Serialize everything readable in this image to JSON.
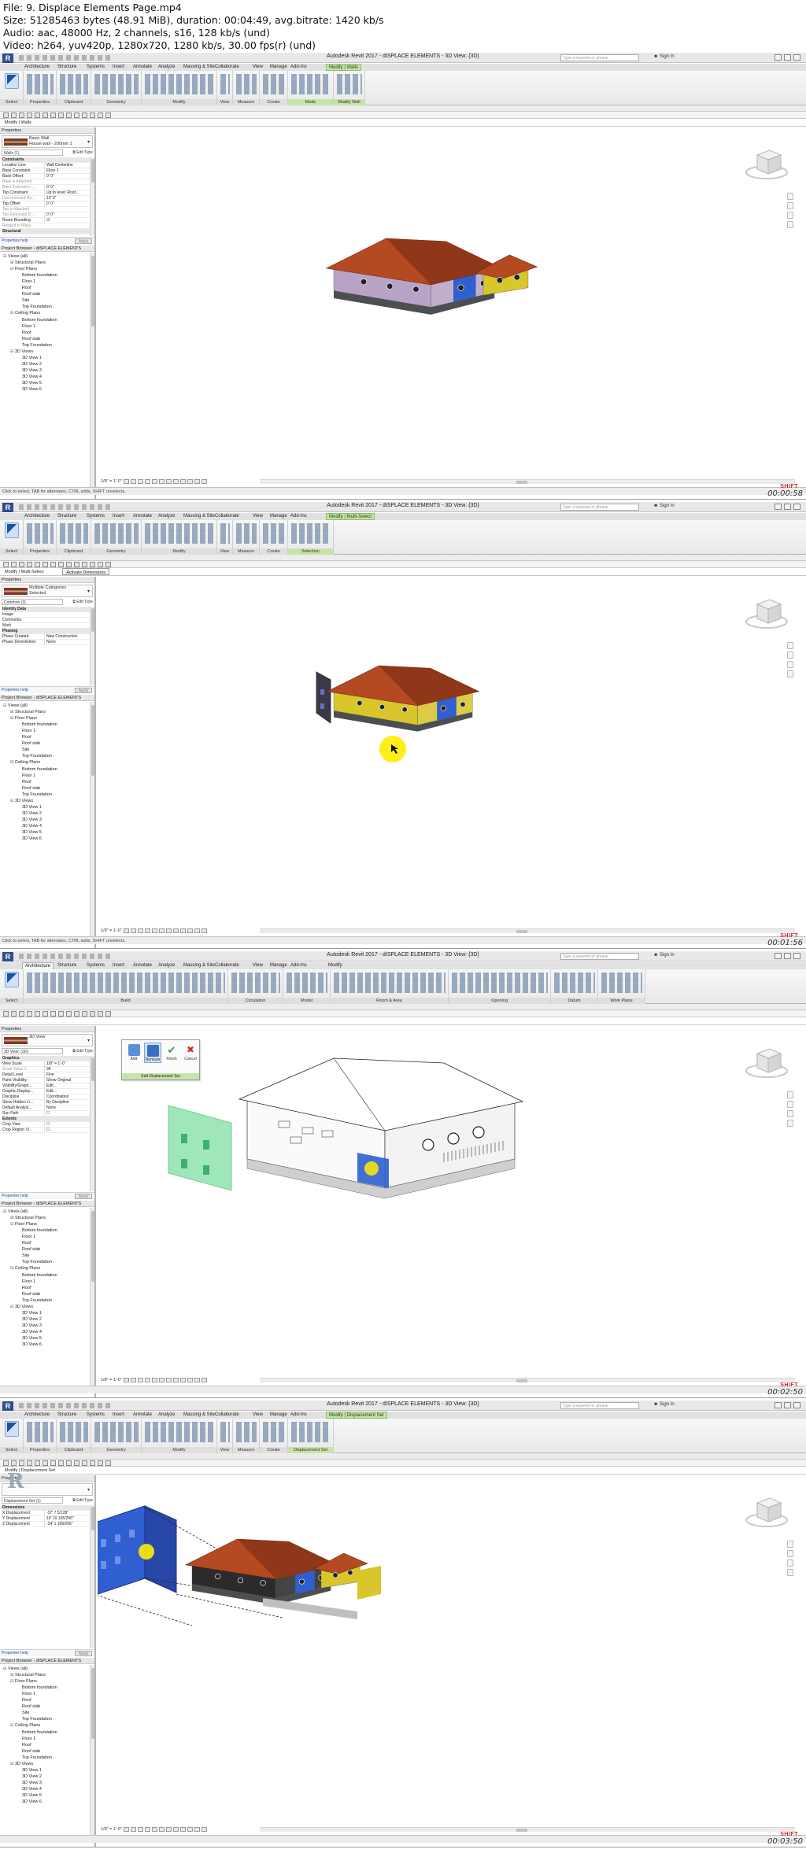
{
  "file_info": [
    "File: 9. Displace Elements Page.mp4",
    "Size: 51285463 bytes (48.91 MiB), duration: 00:04:49, avg.bitrate: 1420 kb/s",
    "Audio: aac, 48000 Hz, 2 channels, s16, 128 kb/s (und)",
    "Video: h264, yuv420p, 1280x720, 1280 kb/s, 30.00 fps(r) (und)"
  ],
  "common": {
    "app_logo": "R",
    "search_placeholder": "Type a keyword or phrase",
    "sign_in": "Sign In",
    "watermark_logo": "SHIFT",
    "apply_label": "Apply",
    "properties_help": "Properties help",
    "edit_type": "Edit Type",
    "view_scale": "1/8\" = 1'-0\""
  },
  "colors": {
    "ctx_tab_green": "#c6e3a9",
    "roof_brown": "#b54a22",
    "wall_yellow": "#d8c62a",
    "wall_lilac": "#b8a3c7",
    "displace_blue": "#2f5fd0",
    "ghost_green": "#7fe0a2",
    "cursor_yellow": "#ffec00"
  },
  "frames": [
    {
      "title": "Autodesk Revit 2017 -   dISPLACE ELEMENTS - 3D View: {3D}",
      "tabs": [
        "Architecture",
        "Structure",
        "Systems",
        "Insert",
        "Annotate",
        "Analyze",
        "Massing & Site",
        "Collaborate",
        "View",
        "Manage",
        "Add-Ins",
        "Modify | Walls"
      ],
      "active_tab": "Modify | Walls",
      "panels": [
        "Select",
        "Properties",
        "Clipboard",
        "Geometry",
        "Modify",
        "View",
        "Measure",
        "Create",
        "Mode",
        "Modify Wall"
      ],
      "subbar": [
        "Select ▾",
        "Properties",
        "Clipboard",
        "Geometry",
        "Modify",
        "View",
        "Measure",
        "Create",
        "Mode",
        "Modify Wall"
      ],
      "ctx_bar": [
        "Modify | Walls"
      ],
      "type_name": "Basic Wall",
      "type_sub": "House wall - 200mm 1",
      "type_filter": "Walls (1)",
      "properties": [
        {
          "k": "Constraints",
          "v": "",
          "cat": true
        },
        {
          "k": "Location Line",
          "v": "Wall Centerline"
        },
        {
          "k": "Base Constraint",
          "v": "Floor 1"
        },
        {
          "k": "Base Offset",
          "v": "0' 0\""
        },
        {
          "k": "Base is Attached",
          "v": "",
          "grey": true
        },
        {
          "k": "Base Extension ...",
          "v": "0' 0\"",
          "grey": true
        },
        {
          "k": "Top Constraint",
          "v": "Up to level: Roof..."
        },
        {
          "k": "Unconnected He...",
          "v": "10' 0\"",
          "grey": true
        },
        {
          "k": "Top Offset",
          "v": "0' 0\""
        },
        {
          "k": "Top is Attached",
          "v": "",
          "grey": true
        },
        {
          "k": "Top Extension D...",
          "v": "0' 0\"",
          "grey": true
        },
        {
          "k": "Room Bounding",
          "v": "☑"
        },
        {
          "k": "Related to Mass",
          "v": "",
          "grey": true
        },
        {
          "k": "Structural",
          "v": "",
          "cat": true
        }
      ],
      "browser_title": "Project Browser - dISPLACE ELEMENTS",
      "browser": [
        {
          "t": "Views (all)",
          "l": 0,
          "g": "⊟"
        },
        {
          "t": "Structural Plans",
          "l": 1,
          "g": "⊞"
        },
        {
          "t": "Floor Plans",
          "l": 1,
          "g": "⊟"
        },
        {
          "t": "Bottom foundation",
          "l": 2,
          "g": ""
        },
        {
          "t": "Floor 1",
          "l": 2,
          "g": ""
        },
        {
          "t": "Roof",
          "l": 2,
          "g": ""
        },
        {
          "t": "Roof slab",
          "l": 2,
          "g": ""
        },
        {
          "t": "Site",
          "l": 2,
          "g": ""
        },
        {
          "t": "Top Foundation",
          "l": 2,
          "g": ""
        },
        {
          "t": "Ceiling Plans",
          "l": 1,
          "g": "⊟"
        },
        {
          "t": "Bottom foundation",
          "l": 2,
          "g": ""
        },
        {
          "t": "Floor 1",
          "l": 2,
          "g": ""
        },
        {
          "t": "Roof",
          "l": 2,
          "g": ""
        },
        {
          "t": "Roof slab",
          "l": 2,
          "g": ""
        },
        {
          "t": "Top Foundation",
          "l": 2,
          "g": ""
        },
        {
          "t": "3D Views",
          "l": 1,
          "g": "⊟"
        },
        {
          "t": "3D View 1",
          "l": 2,
          "g": ""
        },
        {
          "t": "3D View 2",
          "l": 2,
          "g": ""
        },
        {
          "t": "3D View 3",
          "l": 2,
          "g": ""
        },
        {
          "t": "3D View 4",
          "l": 2,
          "g": ""
        },
        {
          "t": "3D View 5",
          "l": 2,
          "g": ""
        },
        {
          "t": "3D View 6",
          "l": 2,
          "g": ""
        }
      ],
      "status": "Click to select, TAB for alternates, CTRL adds, SHIFT unselects.",
      "timestamp": "00:00:58"
    },
    {
      "title": "Autodesk Revit 2017 -   dISPLACE ELEMENTS - 3D View: {3D}",
      "tabs": [
        "Architecture",
        "Structure",
        "Systems",
        "Insert",
        "Annotate",
        "Analyze",
        "Massing & Site",
        "Collaborate",
        "View",
        "Manage",
        "Add-Ins",
        "Modify | Multi-Select"
      ],
      "active_tab": "Modify | Multi-Select",
      "panels": [
        "Select",
        "Properties",
        "Clipboard",
        "Geometry",
        "Modify",
        "View",
        "Measure",
        "Create",
        "Selection"
      ],
      "subbar": [
        "Select ▾",
        "Properties",
        "Clipboard",
        "Geometry",
        "Modify",
        "View",
        "Measure",
        "Create",
        "Selection"
      ],
      "ctx_bar": [
        "Modify | Multi-Select",
        "Activate Dimensions"
      ],
      "type_name": "Multiple Categories",
      "type_sub": "Selected",
      "type_filter": "Common (3)",
      "properties": [
        {
          "k": "Identity Data",
          "v": "",
          "cat": true
        },
        {
          "k": "Image",
          "v": ""
        },
        {
          "k": "Comments",
          "v": ""
        },
        {
          "k": "Mark",
          "v": ""
        },
        {
          "k": "Phasing",
          "v": "",
          "cat": true
        },
        {
          "k": "Phase Created",
          "v": "New Construction"
        },
        {
          "k": "Phase Demolished",
          "v": "None"
        }
      ],
      "browser_title": "Project Browser - dISPLACE ELEMENTS",
      "browser": [
        {
          "t": "Views (all)",
          "l": 0,
          "g": "⊟"
        },
        {
          "t": "Structural Plans",
          "l": 1,
          "g": "⊞"
        },
        {
          "t": "Floor Plans",
          "l": 1,
          "g": "⊟"
        },
        {
          "t": "Bottom foundation",
          "l": 2,
          "g": ""
        },
        {
          "t": "Floor 1",
          "l": 2,
          "g": ""
        },
        {
          "t": "Roof",
          "l": 2,
          "g": ""
        },
        {
          "t": "Roof slab",
          "l": 2,
          "g": ""
        },
        {
          "t": "Site",
          "l": 2,
          "g": ""
        },
        {
          "t": "Top Foundation",
          "l": 2,
          "g": ""
        },
        {
          "t": "Ceiling Plans",
          "l": 1,
          "g": "⊟"
        },
        {
          "t": "Bottom foundation",
          "l": 2,
          "g": ""
        },
        {
          "t": "Floor 1",
          "l": 2,
          "g": ""
        },
        {
          "t": "Roof",
          "l": 2,
          "g": ""
        },
        {
          "t": "Roof slab",
          "l": 2,
          "g": ""
        },
        {
          "t": "Top Foundation",
          "l": 2,
          "g": ""
        },
        {
          "t": "3D Views",
          "l": 1,
          "g": "⊟"
        },
        {
          "t": "3D View 1",
          "l": 2,
          "g": ""
        },
        {
          "t": "3D View 2",
          "l": 2,
          "g": ""
        },
        {
          "t": "3D View 3",
          "l": 2,
          "g": ""
        },
        {
          "t": "3D View 4",
          "l": 2,
          "g": ""
        },
        {
          "t": "3D View 5",
          "l": 2,
          "g": ""
        },
        {
          "t": "3D View 6",
          "l": 2,
          "g": ""
        }
      ],
      "status": "Click to select, TAB for alternates, CTRL adds, SHIFT unselects.",
      "timestamp": "00:01:56"
    },
    {
      "title": "Autodesk Revit 2017 -   dISPLACE ELEMENTS - 3D View: {3D}",
      "tabs": [
        "Architecture",
        "Structure",
        "Systems",
        "Insert",
        "Annotate",
        "Analyze",
        "Massing & Site",
        "Collaborate",
        "View",
        "Manage",
        "Add-Ins",
        "Modify"
      ],
      "active_tab": "Architecture",
      "panels": [
        "Select",
        "Build",
        "Circulation",
        "Model",
        "Room & Area",
        "Opening",
        "Datum",
        "Work Plane"
      ],
      "subbar": [
        "Select ▾",
        "Build",
        "Circulation",
        "Model",
        "Room & Area ▾",
        "Opening",
        "Datum",
        "Work Plane"
      ],
      "ctx_bar": [],
      "type_name": "3D View",
      "type_sub": "",
      "type_filter": "3D View: {3D}",
      "properties": [
        {
          "k": "Graphics",
          "v": "",
          "cat": true
        },
        {
          "k": "View Scale",
          "v": "1/8\" = 1'-0\""
        },
        {
          "k": "Scale Value  1:",
          "v": "96",
          "grey": true
        },
        {
          "k": "Detail Level",
          "v": "Fine"
        },
        {
          "k": "Parts Visibility",
          "v": "Show Original"
        },
        {
          "k": "Visibility/Graph...",
          "v": "Edit..."
        },
        {
          "k": "Graphic Display...",
          "v": "Edit..."
        },
        {
          "k": "Discipline",
          "v": "Coordination"
        },
        {
          "k": "Show Hidden Li...",
          "v": "By Discipline"
        },
        {
          "k": "Default Analysi...",
          "v": "None"
        },
        {
          "k": "Sun Path",
          "v": "☐"
        },
        {
          "k": "Extents",
          "v": "",
          "cat": true
        },
        {
          "k": "Crop View",
          "v": "☐"
        },
        {
          "k": "Crop Region Vi...",
          "v": "☐"
        }
      ],
      "browser_title": "Project Browser - dISPLACE ELEMENTS",
      "browser": [
        {
          "t": "Views (all)",
          "l": 0,
          "g": "⊟"
        },
        {
          "t": "Structural Plans",
          "l": 1,
          "g": "⊞"
        },
        {
          "t": "Floor Plans",
          "l": 1,
          "g": "⊟"
        },
        {
          "t": "Bottom foundation",
          "l": 2,
          "g": ""
        },
        {
          "t": "Floor 1",
          "l": 2,
          "g": ""
        },
        {
          "t": "Roof",
          "l": 2,
          "g": ""
        },
        {
          "t": "Roof slab",
          "l": 2,
          "g": ""
        },
        {
          "t": "Site",
          "l": 2,
          "g": ""
        },
        {
          "t": "Top Foundation",
          "l": 2,
          "g": ""
        },
        {
          "t": "Ceiling Plans",
          "l": 1,
          "g": "⊟"
        },
        {
          "t": "Bottom foundation",
          "l": 2,
          "g": ""
        },
        {
          "t": "Floor 1",
          "l": 2,
          "g": ""
        },
        {
          "t": "Roof",
          "l": 2,
          "g": ""
        },
        {
          "t": "Roof slab",
          "l": 2,
          "g": ""
        },
        {
          "t": "Top Foundation",
          "l": 2,
          "g": ""
        },
        {
          "t": "3D Views",
          "l": 1,
          "g": "⊟"
        },
        {
          "t": "3D View 1",
          "l": 2,
          "g": ""
        },
        {
          "t": "3D View 2",
          "l": 2,
          "g": ""
        },
        {
          "t": "3D View 3",
          "l": 2,
          "g": ""
        },
        {
          "t": "3D View 4",
          "l": 2,
          "g": ""
        },
        {
          "t": "3D View 5",
          "l": 2,
          "g": ""
        },
        {
          "t": "3D View 6",
          "l": 2,
          "g": ""
        }
      ],
      "popup": {
        "buttons": [
          "Add",
          "Remove",
          "Finish",
          "Cancel"
        ],
        "footer": "Edit Displacement Set"
      },
      "status": "",
      "timestamp": "00:02:50"
    },
    {
      "title": "Autodesk Revit 2017 -   dISPLACE ELEMENTS - 3D View: {3D}",
      "tabs": [
        "Architecture",
        "Structure",
        "Systems",
        "Insert",
        "Annotate",
        "Analyze",
        "Massing & Site",
        "Collaborate",
        "View",
        "Manage",
        "Add-Ins",
        "Modify | Displacement Set"
      ],
      "active_tab": "Modify | Displacement Set",
      "panels": [
        "Select",
        "Properties",
        "Clipboard",
        "Geometry",
        "Modify",
        "View",
        "Measure",
        "Create",
        "Displacement Set"
      ],
      "subbar": [
        "Select ▾",
        "Properties",
        "Clipboard",
        "Geometry",
        "Modify",
        "View",
        "Measure",
        "Create",
        "Displacement Set"
      ],
      "ctx_bar": [
        "Modify | Displacement Set"
      ],
      "type_name": "",
      "type_sub": "",
      "type_filter": "Displacement Set (1)",
      "properties": [
        {
          "k": "Dimensions",
          "v": "",
          "cat": true
        },
        {
          "k": "X Displacement",
          "v": "-37' 7 5/128\""
        },
        {
          "k": "Y Displacement",
          "v": "19' 10 105/256\""
        },
        {
          "k": "Z Displacement",
          "v": "-24' 1 169/256\""
        }
      ],
      "browser_title": "Project Browser - dISPLACE ELEMENTS",
      "browser": [
        {
          "t": "Views (all)",
          "l": 0,
          "g": "⊟"
        },
        {
          "t": "Structural Plans",
          "l": 1,
          "g": "⊞"
        },
        {
          "t": "Floor Plans",
          "l": 1,
          "g": "⊟"
        },
        {
          "t": "Bottom foundation",
          "l": 2,
          "g": ""
        },
        {
          "t": "Floor 1",
          "l": 2,
          "g": ""
        },
        {
          "t": "Roof",
          "l": 2,
          "g": ""
        },
        {
          "t": "Roof slab",
          "l": 2,
          "g": ""
        },
        {
          "t": "Site",
          "l": 2,
          "g": ""
        },
        {
          "t": "Top Foundation",
          "l": 2,
          "g": ""
        },
        {
          "t": "Ceiling Plans",
          "l": 1,
          "g": "⊟"
        },
        {
          "t": "Bottom foundation",
          "l": 2,
          "g": ""
        },
        {
          "t": "Floor 1",
          "l": 2,
          "g": ""
        },
        {
          "t": "Roof",
          "l": 2,
          "g": ""
        },
        {
          "t": "Roof slab",
          "l": 2,
          "g": ""
        },
        {
          "t": "Top Foundation",
          "l": 2,
          "g": ""
        },
        {
          "t": "3D Views",
          "l": 1,
          "g": "⊟"
        },
        {
          "t": "3D View 1",
          "l": 2,
          "g": ""
        },
        {
          "t": "3D View 2",
          "l": 2,
          "g": ""
        },
        {
          "t": "3D View 3",
          "l": 2,
          "g": ""
        },
        {
          "t": "3D View 4",
          "l": 2,
          "g": ""
        },
        {
          "t": "3D View 5",
          "l": 2,
          "g": ""
        },
        {
          "t": "3D View 6",
          "l": 2,
          "g": ""
        }
      ],
      "status": "",
      "timestamp": "00:03:50"
    }
  ]
}
